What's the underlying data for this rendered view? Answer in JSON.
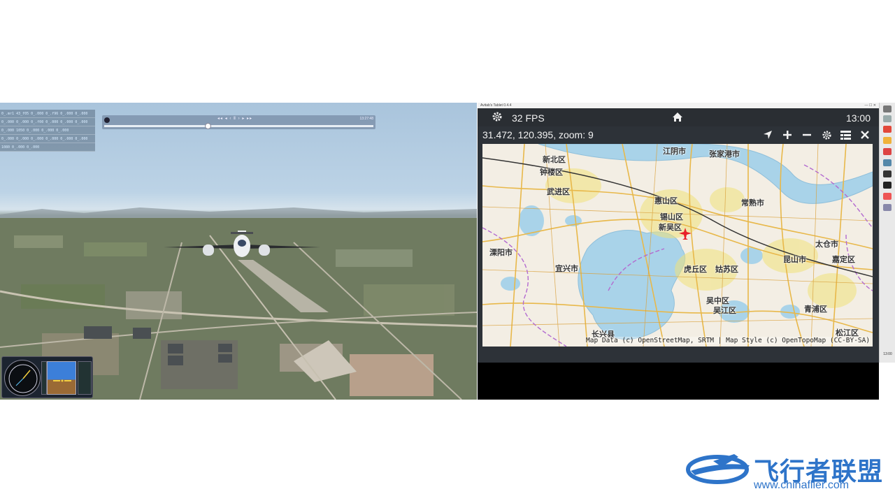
{
  "sim": {
    "replay_controls": "◂◂ ◂ ‹ Ⅱ › ▸ ▸▸",
    "replay_time": "13:27:48",
    "data_rows": [
      "0_.mr1 43_f05  0_.000 0_.f96  0_.000 0_.000",
      "0_.000  0_.000  0_.f00 0_.000 0_.000 0_.000",
      "0_.000  1050  0_.000  0_.000 0_.000",
      "0_.000  0_.000 0_.000 0_.000 0_.000 0_.000",
      "1080 0_.000 0_.000"
    ]
  },
  "window": {
    "title": "Avitab's Tablet  0.4.4",
    "buttons": "—  ☐  ✕"
  },
  "avitab": {
    "fps": "32 FPS",
    "clock": "13:00",
    "coords": "31.472, 120.395, zoom: 9",
    "attribution": "Map Data (c) OpenStreetMap, SRTM | Map Style (c) OpenTopoMap (CC-BY-SA)",
    "places": [
      "新北区",
      "江阴市",
      "张家港市",
      "钟楼区",
      "武进区",
      "常熟市",
      "惠山区",
      "锡山区",
      "新吴区",
      "溧阳市",
      "宜兴市",
      "虎丘区",
      "姑苏区",
      "昆山市",
      "太仓市",
      "嘉定区",
      "吴中区",
      "吴江区",
      "青浦区",
      "长兴县",
      "松江区"
    ]
  },
  "taskbar": {
    "clock": "13:00"
  },
  "watermark": {
    "brand": "飞行者联盟",
    "url": "www.chinaflier.com"
  },
  "colors": {
    "accent": "#2e74c9",
    "map_water": "#a9d3e9",
    "aircraft_marker": "#e8202a"
  }
}
